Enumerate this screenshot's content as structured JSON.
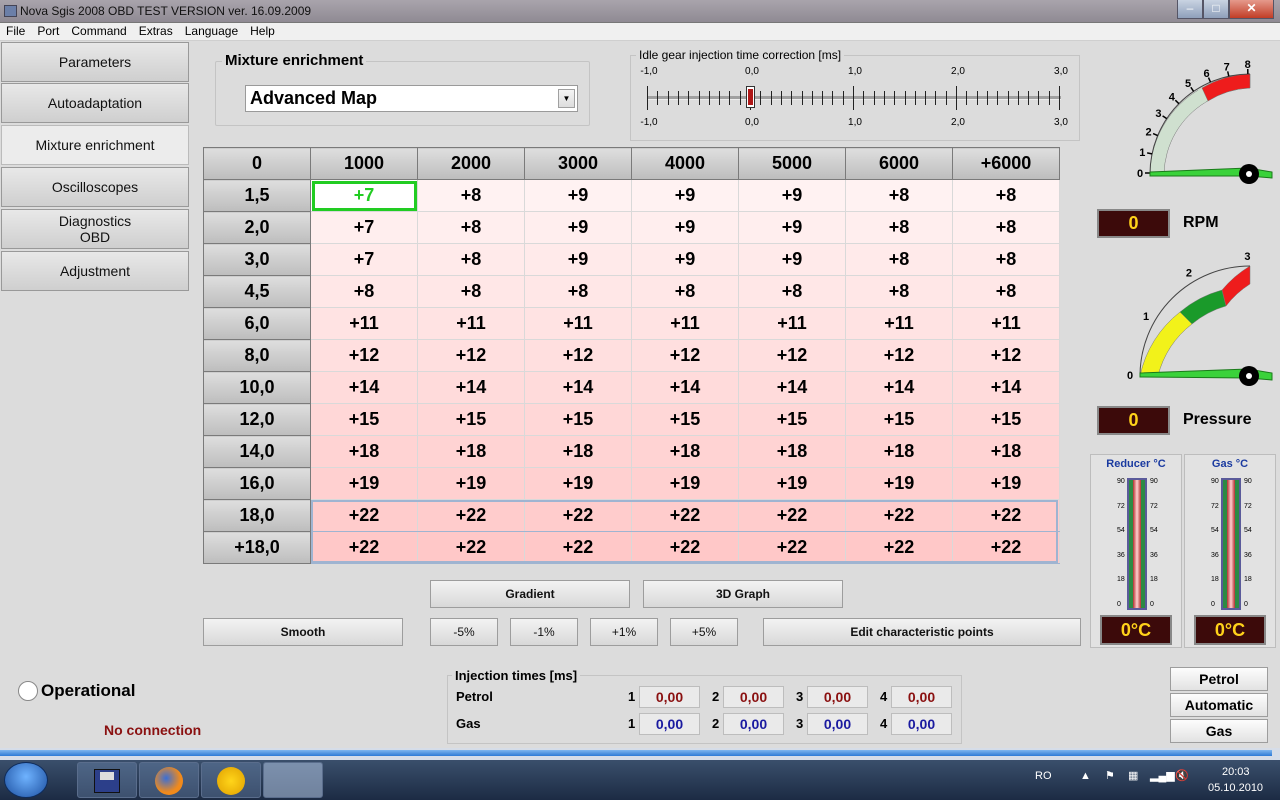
{
  "window": {
    "title": "Nova Sgis 2008 OBD TEST VERSION ver. 16.09.2009"
  },
  "menu": [
    "File",
    "Port",
    "Command",
    "Extras",
    "Language",
    "Help"
  ],
  "nav": [
    "Parameters",
    "Autoadaptation",
    "Mixture enrichment",
    "Oscilloscopes",
    "Diagnostics OBD",
    "Adjustment"
  ],
  "nav_active": "Mixture enrichment",
  "mixture": {
    "legend": "Mixture enrichment",
    "selected": "Advanced Map"
  },
  "idle": {
    "legend": "Idle gear injection time correction [ms]",
    "scale_labels": [
      "-1,0",
      "0,0",
      "1,0",
      "2,0",
      "3,0"
    ],
    "value": 0.0
  },
  "grid": {
    "corner": "0",
    "columns": [
      "1000",
      "2000",
      "3000",
      "4000",
      "5000",
      "6000",
      "+6000"
    ],
    "rows": [
      {
        "label": "1,5",
        "values": [
          "+7",
          "+8",
          "+9",
          "+9",
          "+9",
          "+8",
          "+8"
        ]
      },
      {
        "label": "2,0",
        "values": [
          "+7",
          "+8",
          "+9",
          "+9",
          "+9",
          "+8",
          "+8"
        ]
      },
      {
        "label": "3,0",
        "values": [
          "+7",
          "+8",
          "+9",
          "+9",
          "+9",
          "+8",
          "+8"
        ]
      },
      {
        "label": "4,5",
        "values": [
          "+8",
          "+8",
          "+8",
          "+8",
          "+8",
          "+8",
          "+8"
        ]
      },
      {
        "label": "6,0",
        "values": [
          "+11",
          "+11",
          "+11",
          "+11",
          "+11",
          "+11",
          "+11"
        ]
      },
      {
        "label": "8,0",
        "values": [
          "+12",
          "+12",
          "+12",
          "+12",
          "+12",
          "+12",
          "+12"
        ]
      },
      {
        "label": "10,0",
        "values": [
          "+14",
          "+14",
          "+14",
          "+14",
          "+14",
          "+14",
          "+14"
        ]
      },
      {
        "label": "12,0",
        "values": [
          "+15",
          "+15",
          "+15",
          "+15",
          "+15",
          "+15",
          "+15"
        ]
      },
      {
        "label": "14,0",
        "values": [
          "+18",
          "+18",
          "+18",
          "+18",
          "+18",
          "+18",
          "+18"
        ]
      },
      {
        "label": "16,0",
        "values": [
          "+19",
          "+19",
          "+19",
          "+19",
          "+19",
          "+19",
          "+19"
        ]
      },
      {
        "label": "18,0",
        "values": [
          "+22",
          "+22",
          "+22",
          "+22",
          "+22",
          "+22",
          "+22"
        ]
      },
      {
        "label": "+18,0",
        "values": [
          "+22",
          "+22",
          "+22",
          "+22",
          "+22",
          "+22",
          "+22"
        ]
      }
    ]
  },
  "buttons": {
    "gradient": "Gradient",
    "graph3d": "3D Graph",
    "smooth": "Smooth",
    "m5": "-5%",
    "m1": "-1%",
    "p1": "+1%",
    "p5": "+5%",
    "edit": "Edit characteristic points"
  },
  "status": {
    "operational": "Operational",
    "connection": "No connection"
  },
  "injection": {
    "legend": "Injection times [ms]",
    "petrol_label": "Petrol",
    "gas_label": "Gas",
    "indices": [
      "1",
      "2",
      "3",
      "4"
    ],
    "petrol": [
      "0,00",
      "0,00",
      "0,00",
      "0,00"
    ],
    "gas": [
      "0,00",
      "0,00",
      "0,00",
      "0,00"
    ]
  },
  "rpm_gauge": {
    "ticks": [
      "0",
      "1",
      "2",
      "3",
      "4",
      "5",
      "6",
      "7",
      "8"
    ],
    "value": "0",
    "label": "RPM"
  },
  "pressure_gauge": {
    "ticks": [
      "0",
      "1",
      "2",
      "3"
    ],
    "value": "0",
    "label": "Pressure"
  },
  "reducer": {
    "title": "Reducer °C",
    "scale": [
      "90",
      "72",
      "54",
      "36",
      "18",
      "0"
    ],
    "value": "0°C"
  },
  "gas_temp": {
    "title": "Gas °C",
    "scale": [
      "90",
      "72",
      "54",
      "36",
      "18",
      "0"
    ],
    "value": "0°C"
  },
  "modes": [
    "Petrol",
    "Automatic",
    "Gas"
  ],
  "tray": {
    "lang": "RO",
    "time": "20:03",
    "date": "05.10.2010"
  },
  "colors": {
    "cell_top": "#fff2f2",
    "cell_bottom": "#f8c8c8",
    "selected": "#22cc22",
    "lcd_bg": "#3c0a0a",
    "lcd_fg": "#ffd21a"
  }
}
